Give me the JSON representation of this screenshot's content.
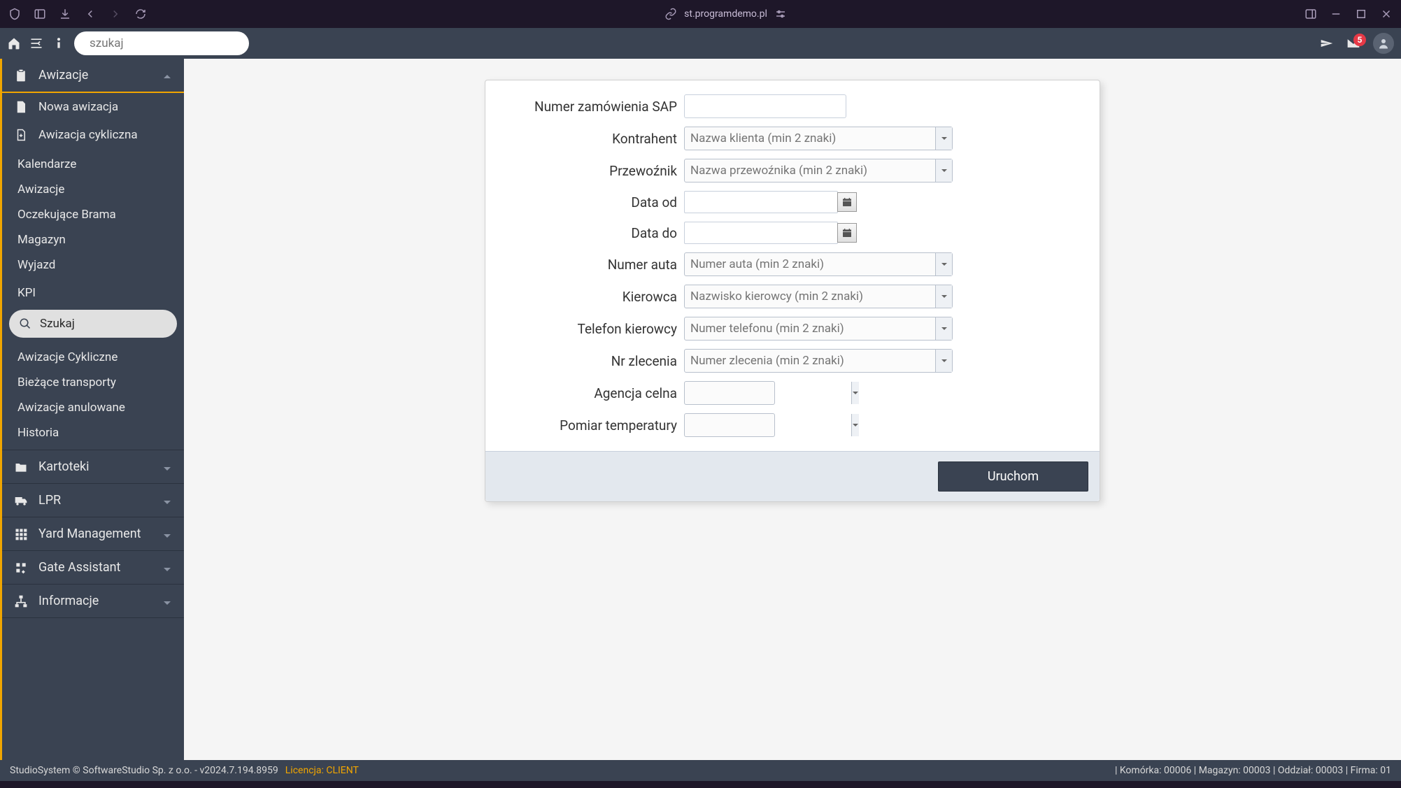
{
  "titlebar": {
    "url": "st.programdemo.pl"
  },
  "header": {
    "search_placeholder": "szukaj",
    "notif_count": "5"
  },
  "sidebar": {
    "sections": {
      "awizacje": "Awizacje",
      "kartoteki": "Kartoteki",
      "lpr": "LPR",
      "yard": "Yard Management",
      "gate": "Gate Assistant",
      "info": "Informacje"
    },
    "items": {
      "nowa_awizacja": "Nowa awizacja",
      "awizacja_cykliczna": "Awizacja cykliczna",
      "kalendarze": "Kalendarze",
      "awizacje_sub": "Awizacje",
      "oczekujace": "Oczekujące Brama",
      "magazyn": "Magazyn",
      "wyjazd": "Wyjazd",
      "kpi": "KPI",
      "szukaj": "Szukaj",
      "awizacje_cykliczne": "Awizacje Cykliczne",
      "biezace": "Bieżące transporty",
      "anulowane": "Awizacje anulowane",
      "historia": "Historia"
    }
  },
  "form": {
    "labels": {
      "sap": "Numer zamówienia SAP",
      "kontrahent": "Kontrahent",
      "przewoznik": "Przewoźnik",
      "data_od": "Data od",
      "data_do": "Data do",
      "numer_auta": "Numer auta",
      "kierowca": "Kierowca",
      "telefon": "Telefon kierowcy",
      "nr_zlecenia": "Nr zlecenia",
      "agencja": "Agencja celna",
      "pomiar": "Pomiar temperatury"
    },
    "placeholders": {
      "kontrahent": "Nazwa klienta (min 2 znaki)",
      "przewoznik": "Nazwa przewoźnika (min 2 znaki)",
      "numer_auta": "Numer auta (min 2 znaki)",
      "kierowca": "Nazwisko kierowcy (min 2 znaki)",
      "telefon": "Numer telefonu (min 2 znaki)",
      "nr_zlecenia": "Numer zlecenia (min 2 znaki)"
    },
    "run": "Uruchom"
  },
  "statusbar": {
    "left": "StudioSystem © SoftwareStudio Sp. z o.o. - v2024.7.194.8959",
    "license": "Licencja: CLIENT",
    "right": "| Komórka: 00006 | Magazyn: 00003 | Oddział: 00003 | Firma: 01"
  }
}
